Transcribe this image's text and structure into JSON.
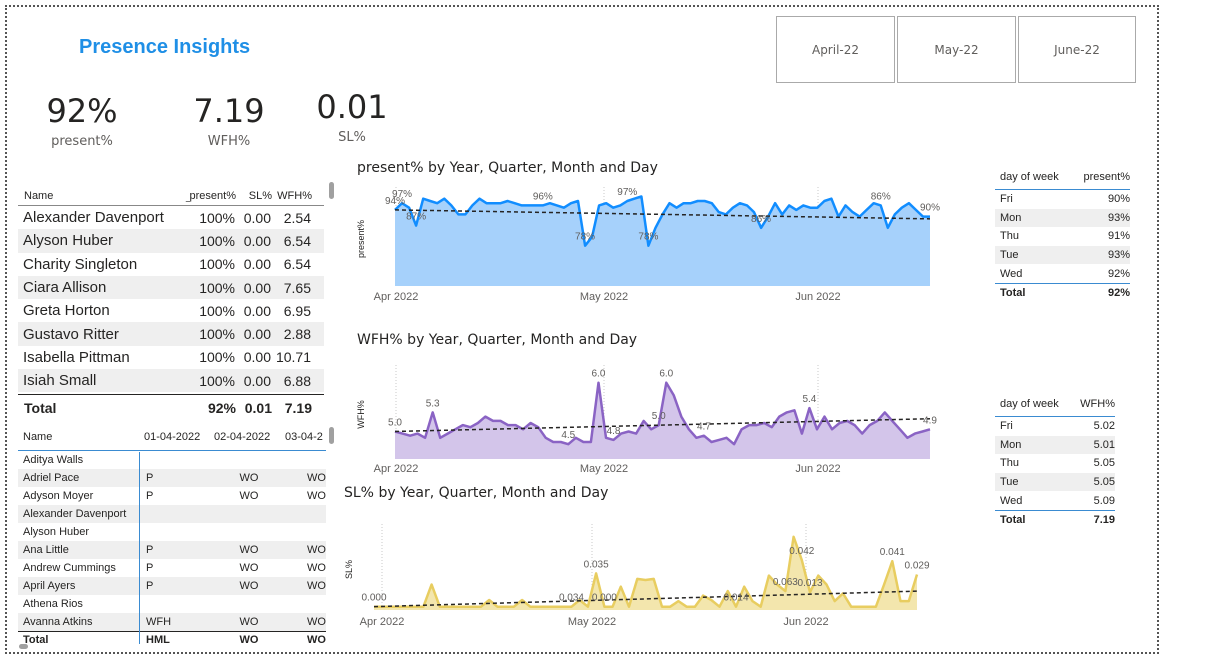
{
  "report": {
    "title": "Presence Insights",
    "kpis": [
      {
        "value": "92%",
        "label": "present%"
      },
      {
        "value": "7.19",
        "label": "WFH%"
      },
      {
        "value": "0.01",
        "label": "SL%"
      }
    ],
    "month_slicer": [
      "April-22",
      "May-22",
      "June-22"
    ]
  },
  "employee_table": {
    "headers": [
      "Name",
      "present%",
      "SL%",
      "WFH%"
    ],
    "rows": [
      [
        "Alexander Davenport",
        "100%",
        "0.00",
        "2.54"
      ],
      [
        "Alyson Huber",
        "100%",
        "0.00",
        "6.54"
      ],
      [
        "Charity Singleton",
        "100%",
        "0.00",
        "6.54"
      ],
      [
        "Ciara Allison",
        "100%",
        "0.00",
        "7.65"
      ],
      [
        "Greta Horton",
        "100%",
        "0.00",
        "6.95"
      ],
      [
        "Gustavo Ritter",
        "100%",
        "0.00",
        "2.88"
      ],
      [
        "Isabella Pittman",
        "100%",
        "0.00",
        "10.71"
      ],
      [
        "Isiah Small",
        "100%",
        "0.00",
        "6.88"
      ]
    ],
    "total": [
      "Total",
      "92%",
      "0.01",
      "7.19"
    ]
  },
  "attendance_matrix": {
    "headers": [
      "Name",
      "01-04-2022",
      "02-04-2022",
      "03-04-2"
    ],
    "rows": [
      [
        "Aditya Walls",
        "",
        "",
        ""
      ],
      [
        "Adriel Pace",
        "P",
        "WO",
        "WO"
      ],
      [
        "Adyson Moyer",
        "P",
        "WO",
        "WO"
      ],
      [
        "Alexander Davenport",
        "",
        "",
        ""
      ],
      [
        "Alyson Huber",
        "",
        "",
        ""
      ],
      [
        "Ana Little",
        "P",
        "WO",
        "WO"
      ],
      [
        "Andrew Cummings",
        "P",
        "WO",
        "WO"
      ],
      [
        "April Ayers",
        "P",
        "WO",
        "WO"
      ],
      [
        "Athena Rios",
        "",
        "",
        ""
      ],
      [
        "Avanna Atkins",
        "WFH",
        "WO",
        "WO"
      ]
    ],
    "total": [
      "Total",
      "HML",
      "WO",
      "WO"
    ]
  },
  "present_by_day": {
    "headers": [
      "day of week",
      "present%"
    ],
    "rows": [
      [
        "Fri",
        "90%"
      ],
      [
        "Mon",
        "93%"
      ],
      [
        "Thu",
        "91%"
      ],
      [
        "Tue",
        "93%"
      ],
      [
        "Wed",
        "92%"
      ]
    ],
    "total": [
      "Total",
      "92%"
    ]
  },
  "wfh_by_day": {
    "headers": [
      "day of week",
      "WFH%"
    ],
    "rows": [
      [
        "Fri",
        "5.02"
      ],
      [
        "Mon",
        "5.01"
      ],
      [
        "Thu",
        "5.05"
      ],
      [
        "Tue",
        "5.05"
      ],
      [
        "Wed",
        "5.09"
      ]
    ],
    "total": [
      "Total",
      "7.19"
    ]
  },
  "chart_data": [
    {
      "type": "area",
      "title": "present% by Year, Quarter, Month and Day",
      "ylabel": "present%",
      "xlabel": "",
      "x_ticks": [
        "Apr 2022",
        "May 2022",
        "Jun 2022"
      ],
      "ylim": [
        60,
        102
      ],
      "color": "#118dff",
      "fill": "#a6d1fb",
      "trend": [
        94,
        90
      ],
      "values": [
        94,
        97,
        95,
        87,
        99,
        98,
        97,
        99,
        96,
        92,
        92,
        96,
        99,
        97,
        97,
        97,
        98,
        97,
        96,
        96,
        96,
        96,
        97,
        96,
        95,
        97,
        98,
        78,
        82,
        96,
        97,
        95,
        96,
        98,
        99,
        100,
        78,
        86,
        92,
        97,
        95,
        97,
        97,
        98,
        98,
        97,
        93,
        92,
        95,
        97,
        96,
        93,
        86,
        91,
        97,
        92,
        96,
        94,
        96,
        95,
        95,
        98,
        99,
        91,
        96,
        93,
        91,
        94,
        97,
        96,
        86,
        92,
        95,
        97,
        94,
        91,
        91
      ],
      "data_labels": [
        {
          "index": 0,
          "text": "94%"
        },
        {
          "index": 1,
          "text": "97%"
        },
        {
          "index": 3,
          "text": "87%"
        },
        {
          "index": 21,
          "text": "96%"
        },
        {
          "index": 27,
          "text": "78%"
        },
        {
          "index": 33,
          "text": "97%"
        },
        {
          "index": 36,
          "text": "78%"
        },
        {
          "index": 52,
          "text": "86%"
        },
        {
          "index": 69,
          "text": "86%"
        },
        {
          "index": 76,
          "text": "90%"
        }
      ]
    },
    {
      "type": "area",
      "title": "WFH% by Year, Quarter, Month and Day",
      "ylabel": "WFH%",
      "xlabel": "",
      "x_ticks": [
        "Apr 2022",
        "May 2022",
        "Jun 2022"
      ],
      "ylim": [
        4.2,
        6.3
      ],
      "color": "#8a63c4",
      "fill": "#d3c5ea",
      "trend": [
        4.85,
        5.15
      ],
      "values": [
        4.85,
        4.8,
        4.75,
        4.8,
        4.7,
        5.3,
        4.7,
        4.8,
        4.9,
        5.0,
        4.95,
        5.05,
        5.2,
        5.1,
        5.1,
        5.0,
        5.0,
        4.9,
        5.05,
        4.95,
        4.7,
        4.6,
        4.6,
        4.55,
        4.7,
        4.6,
        4.6,
        6.0,
        4.7,
        4.65,
        4.8,
        4.85,
        4.8,
        5.1,
        4.9,
        5.0,
        6.0,
        5.7,
        5.2,
        4.9,
        4.7,
        4.75,
        4.6,
        4.65,
        4.7,
        4.55,
        4.9,
        5.0,
        5.0,
        5.05,
        4.95,
        5.2,
        5.3,
        5.35,
        4.8,
        5.4,
        4.9,
        5.2,
        4.9,
        5.05,
        5.1,
        5.0,
        4.8,
        5.0,
        5.1,
        5.3,
        5.1,
        4.9,
        4.7,
        4.8,
        4.85,
        4.9
      ],
      "data_labels": [
        {
          "index": 0,
          "text": "5.0"
        },
        {
          "index": 5,
          "text": "5.3"
        },
        {
          "index": 23,
          "text": "4.5"
        },
        {
          "index": 27,
          "text": "6.0"
        },
        {
          "index": 29,
          "text": "4.8"
        },
        {
          "index": 35,
          "text": "5.0"
        },
        {
          "index": 36,
          "text": "6.0"
        },
        {
          "index": 41,
          "text": "4.7"
        },
        {
          "index": 55,
          "text": "5.4"
        },
        {
          "index": 71,
          "text": "4.9"
        }
      ]
    },
    {
      "type": "area",
      "title": "SL% by Year, Quarter, Month and Day",
      "ylabel": "SL%",
      "xlabel": "",
      "x_ticks": [
        "Apr 2022",
        "May 2022",
        "Jun 2022"
      ],
      "ylim": [
        -0.003,
        0.07
      ],
      "color": "#e8cd60",
      "fill": "#f3e6ad",
      "trend": [
        0.0,
        0.014
      ],
      "values": [
        0,
        0,
        0,
        0,
        0,
        0,
        0,
        0.02,
        0,
        0,
        0,
        0,
        0,
        0,
        0.006,
        0,
        0,
        0,
        0.006,
        0,
        0,
        0,
        0,
        0,
        0,
        0.006,
        0,
        0.03,
        0,
        0,
        0.018,
        0,
        0.025,
        0.024,
        0.025,
        0,
        0,
        0.005,
        0,
        0,
        0.01,
        0.006,
        0.0,
        0.014,
        0.0,
        0.018,
        0.005,
        0.0,
        0.028,
        0.02,
        0.014,
        0.063,
        0.042,
        0.013,
        0.028,
        0.02,
        0.005,
        0.012,
        0,
        0,
        0,
        0,
        0.02,
        0.041,
        0.005,
        0.005,
        0.029
      ],
      "data_labels": [
        {
          "index": 0,
          "text": "0.000"
        },
        {
          "index": 24,
          "text": "0.034"
        },
        {
          "index": 27,
          "text": "0.035"
        },
        {
          "index": 28,
          "text": "0.000"
        },
        {
          "index": 44,
          "text": "0.014"
        },
        {
          "index": 50,
          "text": "0.063"
        },
        {
          "index": 52,
          "text": "0.042"
        },
        {
          "index": 53,
          "text": "0.013"
        },
        {
          "index": 63,
          "text": "0.041"
        },
        {
          "index": 66,
          "text": "0.029"
        }
      ]
    }
  ]
}
